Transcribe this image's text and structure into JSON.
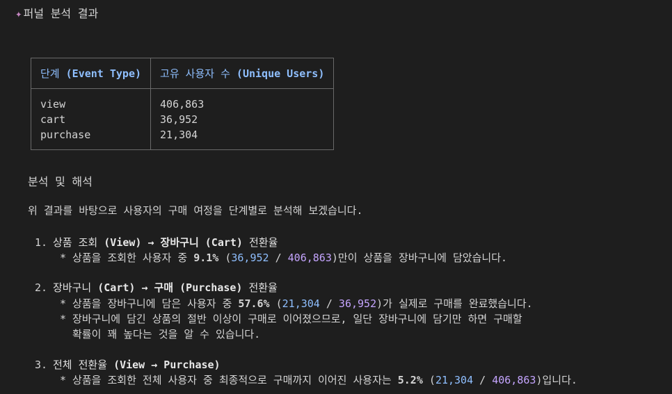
{
  "title": {
    "icon": "sparkle-icon",
    "text": "퍼널 분석 결과"
  },
  "table": {
    "headers": [
      {
        "ko": "단계",
        "en": "(Event Type)"
      },
      {
        "ko": "고유 사용자 수",
        "en": "(Unique Users)"
      }
    ],
    "rows": [
      {
        "stage": "view",
        "users": "406,863"
      },
      {
        "stage": "cart",
        "users": "36,952"
      },
      {
        "stage": "purchase",
        "users": "21,304"
      }
    ]
  },
  "analysis": {
    "heading": "분석 및 해석",
    "intro": "위 결과를 바탕으로 사용자의 구매 여정을 단계별로 분석해 보겠습니다.",
    "items": [
      {
        "num": "1.",
        "title_a": "상품 조회",
        "title_b": "(View) → 장바구니 (Cart)",
        "title_c": "전환율",
        "bullet": {
          "prefix": "* 상품을 조회한 사용자 중 ",
          "pct": "9.1%",
          "open": " (",
          "n1": "36,952",
          "sep": " / ",
          "n2": "406,863",
          "suffix": ")만이 상품을 장바구니에 담았습니다."
        }
      },
      {
        "num": "2.",
        "title_a": "장바구니",
        "title_b": "(Cart) → 구매 (Purchase)",
        "title_c": "전환율",
        "bullet": {
          "prefix": "* 상품을 장바구니에 담은 사용자 중 ",
          "pct": "57.6%",
          "open": " (",
          "n1": "21,304",
          "sep": " / ",
          "n2": "36,952",
          "suffix": ")가 실제로 구매를 완료했습니다."
        },
        "bullet2": "* 장바구니에 담긴 상품의 절반 이상이 구매로 이어졌으므로, 일단 장바구니에 담기만 하면 구매할",
        "bullet2_cont": "확률이 꽤 높다는 것을 알 수 있습니다."
      },
      {
        "num": "3.",
        "title_a": "전체 전환율",
        "title_b": "(View → Purchase)",
        "bullet": {
          "prefix": "* 상품을 조회한 전체 사용자 중 최종적으로 구매까지 이어진 사용자는 ",
          "pct": "5.2%",
          "open": " (",
          "n1": "21,304",
          "sep": " / ",
          "n2": "406,863",
          "suffix": ")입니다."
        }
      }
    ]
  },
  "colors": {
    "background": "#1e1e1e",
    "text": "#d4d4d4",
    "header": "#8fbfff",
    "number_accent": "#c5a5ff"
  }
}
